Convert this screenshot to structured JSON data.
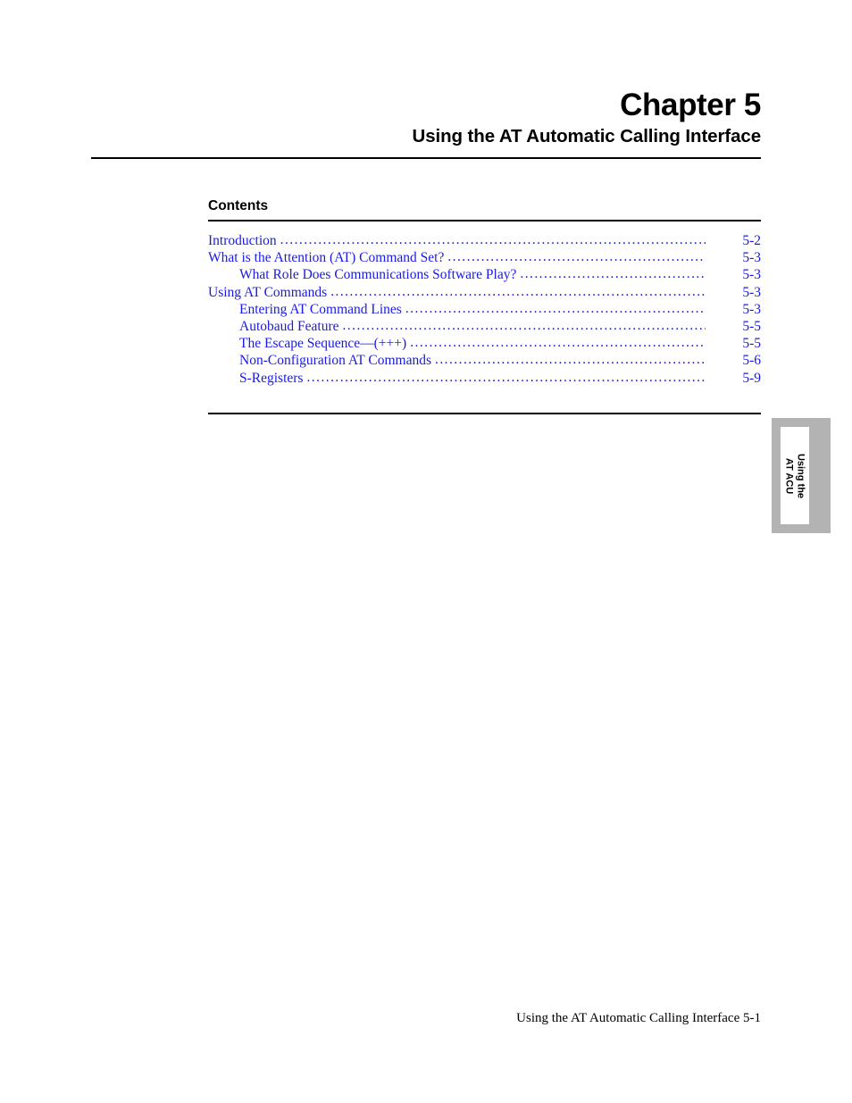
{
  "header": {
    "chapter_number": "Chapter 5",
    "chapter_title": "Using the AT Automatic Calling Interface"
  },
  "contents": {
    "heading": "Contents",
    "entries": [
      {
        "label": "Introduction",
        "page": "5-2",
        "level": 0
      },
      {
        "label": "What is the Attention (AT) Command Set?",
        "page": "5-3",
        "level": 0
      },
      {
        "label": "What Role Does Communications Software Play?",
        "page": "5-3",
        "level": 1
      },
      {
        "label": "Using AT Commands",
        "page": "5-3",
        "level": 0
      },
      {
        "label": "Entering AT Command Lines",
        "page": "5-3",
        "level": 1
      },
      {
        "label": "Autobaud Feature",
        "page": "5-5",
        "level": 1
      },
      {
        "label": "The Escape Sequence—(+++)",
        "page": "5-5",
        "level": 1
      },
      {
        "label": "Non-Configuration AT Commands",
        "page": "5-6",
        "level": 1
      },
      {
        "label": "S-Registers",
        "page": "5-9",
        "level": 1
      }
    ]
  },
  "side_tab": {
    "line1": "Using the",
    "line2": "AT ACU"
  },
  "footer": {
    "text": "Using the AT Automatic Calling Interface 5-1"
  },
  "colors": {
    "toc_link": "#1a1ae6",
    "tab_gray": "#b3b3b3",
    "text": "#000000"
  }
}
